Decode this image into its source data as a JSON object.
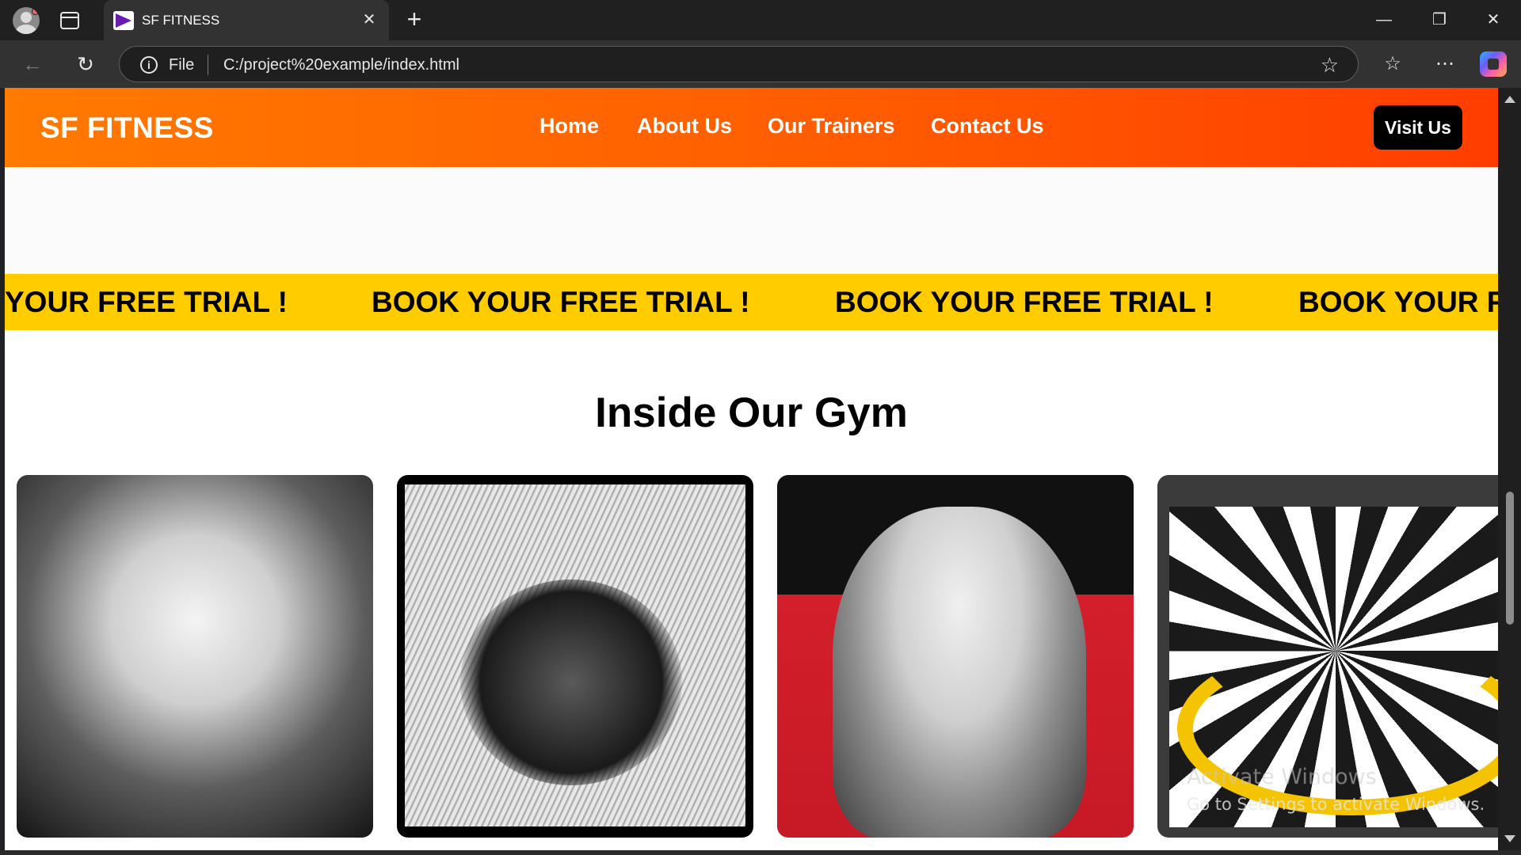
{
  "browser": {
    "tab_title": "SF FITNESS",
    "address_scheme": "File",
    "address_url": "C:/project%20example/index.html",
    "icons": {
      "profile": "profile-avatar-icon",
      "tab_actions": "tab-actions-icon",
      "favicon": "site-favicon-icon",
      "close_tab": "close-icon",
      "new_tab": "plus-icon",
      "minimize": "minimize-icon",
      "restore": "restore-icon",
      "close_window": "close-icon",
      "back": "back-arrow-icon",
      "refresh": "refresh-icon",
      "info": "info-icon",
      "favorite": "star-icon",
      "favorites": "favorites-icon",
      "more": "more-icon",
      "copilot": "copilot-icon"
    }
  },
  "site": {
    "brand": "SF FITNESS",
    "nav": [
      "Home",
      "About Us",
      "Our Trainers",
      "Contact Us"
    ],
    "cta": "Visit Us",
    "accent_colors": {
      "header_start": "#ff7a00",
      "header_end": "#ff3d00",
      "marquee": "#ffcc00",
      "button": "#000000"
    },
    "marquee_text": [
      "YOUR FREE TRIAL !",
      "BOOK YOUR FREE TRIAL !",
      "BOOK YOUR FREE TRIAL !",
      "BOOK YOUR F"
    ],
    "gallery_title": "Inside Our Gym",
    "gallery_images": [
      "gym-image-1",
      "gym-image-2",
      "gym-image-3",
      "gym-image-4"
    ]
  },
  "overlay": {
    "activation_title": "Activate Windows",
    "activation_message": "Go to Settings to activate Windows."
  }
}
